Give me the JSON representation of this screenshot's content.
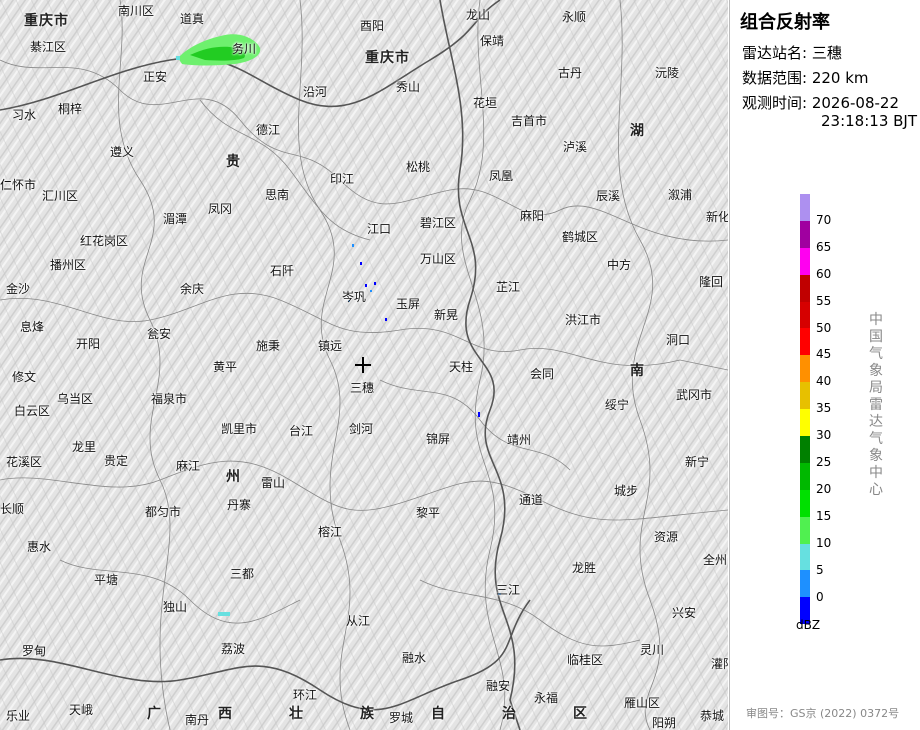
{
  "panel": {
    "title": "组合反射率",
    "station_label": "雷达站名:",
    "station_value": "三穗",
    "range_label": "数据范围:",
    "range_value": "220 km",
    "time_label": "观测时间:",
    "time_date": "2026-08-22",
    "time_clock": "23:18:13 BJT",
    "agency": "中国气象局雷达气象中心",
    "approval": "审图号：GS京 (2022) 0372号"
  },
  "legend": {
    "unit": "dBZ",
    "ticks": [
      "70",
      "65",
      "60",
      "55",
      "50",
      "45",
      "40",
      "35",
      "30",
      "25",
      "20",
      "15",
      "10",
      "5",
      "0"
    ],
    "colors": [
      "#ad90f0",
      "#a000a0",
      "#ff00f0",
      "#c00000",
      "#d60000",
      "#ff0000",
      "#ff9000",
      "#e7c000",
      "#ffff00",
      "#008000",
      "#00b800",
      "#00e000",
      "#50f050",
      "#66e0e0",
      "#1e90ff",
      "#0000ff"
    ]
  },
  "map": {
    "provinces": [
      "重庆市",
      "重庆市",
      "贵",
      "湖",
      "南",
      "州",
      "广",
      "西",
      "壮",
      "族",
      "自",
      "治",
      "区"
    ],
    "places": [
      "南川区",
      "道真",
      "酉阳",
      "龙山",
      "永顺",
      "綦江区",
      "务川",
      "保靖",
      "正安",
      "秀山",
      "古丹",
      "沅陵",
      "习水",
      "桐梓",
      "沿河",
      "花垣",
      "吉首市",
      "遵义",
      "德江",
      "泸溪",
      "仁怀市",
      "汇川区",
      "思南",
      "印江",
      "松桃",
      "凤凰",
      "辰溪",
      "溆浦",
      "湄潭",
      "凤冈",
      "江口",
      "碧江区",
      "麻阳",
      "鹤城区",
      "新化",
      "红花岗区",
      "播州区",
      "石阡",
      "万山区",
      "中方",
      "隆回",
      "金沙",
      "余庆",
      "岑巩",
      "玉屏",
      "芷江",
      "息烽",
      "开阳",
      "瓮安",
      "施秉",
      "镇远",
      "新晃",
      "洪江市",
      "洞口",
      "修文",
      "黄平",
      "天柱",
      "会同",
      "乌当区",
      "福泉市",
      "三穗",
      "绥宁",
      "武冈市",
      "白云区",
      "凯里市",
      "台江",
      "剑河",
      "锦屏",
      "靖州",
      "花溪区",
      "龙里",
      "贵定",
      "麻江",
      "新宁",
      "雷山",
      "通道",
      "城步",
      "长顺",
      "都匀市",
      "丹寨",
      "黎平",
      "惠水",
      "榕江",
      "资源",
      "全州",
      "平塘",
      "三都",
      "龙胜",
      "三江",
      "独山",
      "兴安",
      "罗甸",
      "荔波",
      "从江",
      "融水",
      "临桂区",
      "灵川",
      "灌阳",
      "乐业",
      "天峨",
      "南丹",
      "环江",
      "罗城",
      "融安",
      "永福",
      "雁山区",
      "阳朔",
      "恭城"
    ]
  }
}
